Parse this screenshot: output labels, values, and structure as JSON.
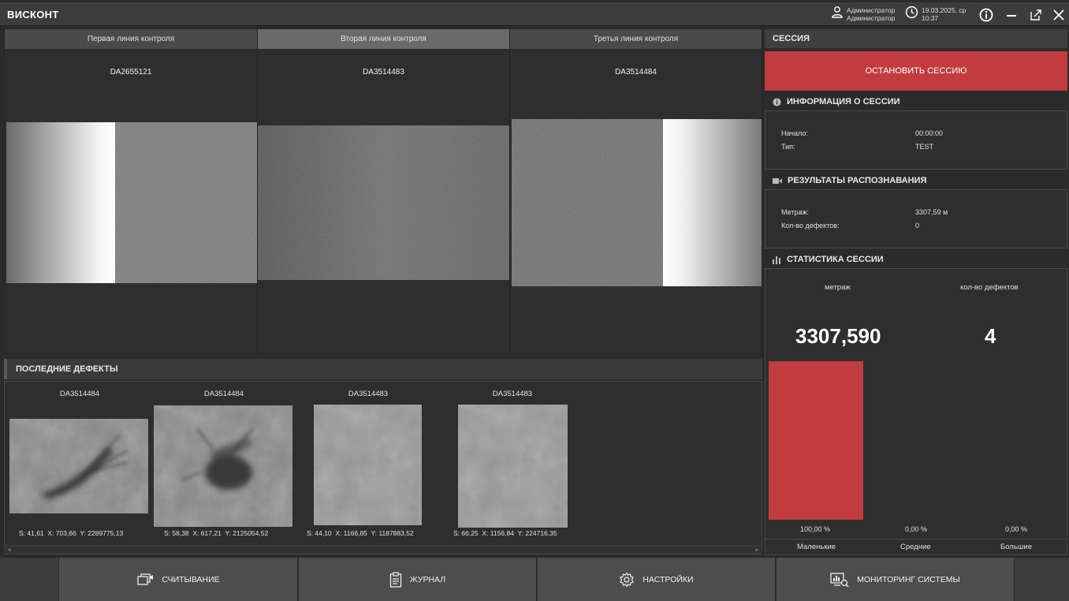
{
  "app": {
    "title": "ВИСКОНТ"
  },
  "header": {
    "user_line1": "Администратор",
    "user_line2": "Администратор",
    "date_line": "19.03.2025, ср",
    "time_line": "10:37"
  },
  "cameras": [
    {
      "tab": "Первая линия контроля",
      "code": "DA2655121",
      "active": false
    },
    {
      "tab": "Вторая линия контроля",
      "code": "DA3514483",
      "active": true
    },
    {
      "tab": "Третья линия контроля",
      "code": "DA3514484",
      "active": false
    }
  ],
  "defects": {
    "title": "ПОСЛЕДНИЕ ДЕФЕКТЫ",
    "items": [
      {
        "code": "DA3514484",
        "s": "S: 41,61",
        "x": "X: 703,66",
        "y": "Y: 2289775,13"
      },
      {
        "code": "DA3514484",
        "s": "S: 58,38",
        "x": "X: 617,21",
        "y": "Y: 2125054,52"
      },
      {
        "code": "DA3514483",
        "s": "S: 44,10",
        "x": "X: 1166,85",
        "y": "Y: 1187883,52"
      },
      {
        "code": "DA3514483",
        "s": "S: 66,25",
        "x": "X: 1156,84",
        "y": "Y: 224716,35"
      }
    ]
  },
  "session": {
    "title": "СЕССИЯ",
    "stop_label": "ОСТАНОВИТЬ СЕССИЮ",
    "info_title": "ИНФОРМАЦИЯ О СЕССИИ",
    "start_label": "Начало:",
    "start_value": "00:00:00",
    "type_label": "Тип:",
    "type_value": "TEST",
    "results_title": "РЕЗУЛЬТАТЫ РАСПОЗНАВАНИЯ",
    "meter_label": "Метраж:",
    "meter_value": "3307,59 м",
    "defects_label": "Кол-во дефектов:",
    "defects_value": "0",
    "stats_title": "СТАТИСТИКА СЕССИИ",
    "stat_meter_label": "метраж",
    "stat_defects_label": "кол-во дефектов",
    "stat_meter_value": "3307,590",
    "stat_defects_value": "4"
  },
  "chart_data": {
    "type": "bar",
    "categories": [
      "Маленькие",
      "Средние",
      "Большие"
    ],
    "values": [
      100.0,
      0.0,
      0.0
    ],
    "labels": [
      "100,00 %",
      "0,00 %",
      "0,00 %"
    ],
    "ylim": [
      0,
      100
    ],
    "bar_color": "#c13b3f"
  },
  "nav": {
    "read_label": "СЧИТЫВАНИЕ",
    "journal_label": "ЖУРНАЛ",
    "settings_label": "НАСТРОЙКИ",
    "monitor_label": "МОНИТОРИНГ СИСТЕМЫ"
  },
  "colors": {
    "accent": "#c13b3f",
    "background": "#2b2b2b",
    "panel": "#2e2e2e"
  }
}
